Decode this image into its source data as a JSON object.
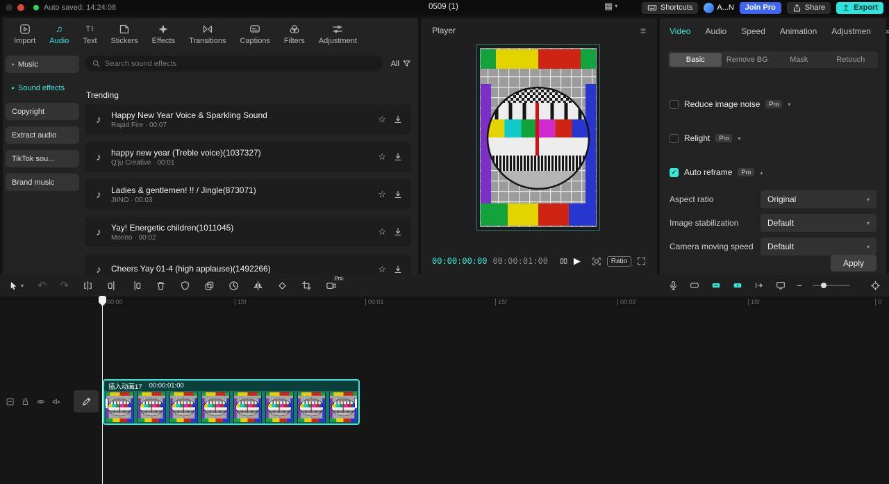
{
  "window": {
    "auto_saved": "Auto saved: 14:24:08",
    "title": "0509 (1)",
    "shortcuts_label": "Shortcuts",
    "account_label": "A...N",
    "join_pro_label": "Join Pro",
    "share_label": "Share",
    "export_label": "Export"
  },
  "media_tabs": [
    "Import",
    "Audio",
    "Text",
    "Stickers",
    "Effects",
    "Transitions",
    "Captions",
    "Filters",
    "Adjustment"
  ],
  "sidebar": [
    "Music",
    "Sound effects",
    "Copyright",
    "Extract audio",
    "TikTok sou...",
    "Brand music"
  ],
  "search": {
    "placeholder": "Search sound effects",
    "filter_label": "All"
  },
  "sounds": {
    "heading": "Trending",
    "items": [
      {
        "title": "Happy New Year Voice & Sparkling Sound",
        "meta": "Rapid Fire · 00:07"
      },
      {
        "title": "happy new year (Treble voice)(1037327)",
        "meta": "Q'ju Creative · 00:01"
      },
      {
        "title": "Ladies & gentlemen! !! / Jingle(873071)",
        "meta": "JIINO · 00:03"
      },
      {
        "title": "Yay! Energetic children(1011045)",
        "meta": "Morino · 00:02"
      },
      {
        "title": "Cheers Yay 01-4 (high applause)(1492266)",
        "meta": ""
      }
    ]
  },
  "player": {
    "title": "Player",
    "current_time": "00:00:00:00",
    "total_time": "00:00:01:00",
    "ratio_label": "Ratio"
  },
  "inspector": {
    "tabs": [
      "Video",
      "Audio",
      "Speed",
      "Animation",
      "Adjustmen"
    ],
    "subtabs": [
      "Basic",
      "Remove BG",
      "Mask",
      "Retouch"
    ],
    "toggles": [
      {
        "label": "Reduce image noise",
        "badge": "Pro",
        "checked": false
      },
      {
        "label": "Relight",
        "badge": "Pro",
        "checked": false
      },
      {
        "label": "Auto reframe",
        "badge": "Pro",
        "checked": true
      }
    ],
    "fields": [
      {
        "label": "Aspect ratio",
        "value": "Original"
      },
      {
        "label": "Image stabilization",
        "value": "Default"
      },
      {
        "label": "Camera moving speed",
        "value": "Default"
      }
    ],
    "apply_label": "Apply"
  },
  "toolbar": {
    "pro_badge": "Pro"
  },
  "timeline": {
    "ruler": [
      "00:00",
      "15f",
      "00:01",
      "15f",
      "00:02",
      "15f",
      "0"
    ],
    "clip": {
      "name": "插入动画17",
      "duration": "00:00:01:00"
    }
  },
  "icons": {
    "note": "♪",
    "audio_tab": "♫",
    "text_tab": "TI",
    "star": "☆",
    "play": "▶",
    "caret_down": "▾",
    "caret_up": "▴",
    "caret_right": "▸",
    "more": "»",
    "menu": "≡",
    "undo": "↶",
    "redo": "↷",
    "layout": "▦",
    "check": "✓",
    "minus": "−"
  },
  "colors": {
    "accent": "#3ae8da",
    "join_pro_blue": "#3f66f0",
    "export_cyan": "#2fe3dd"
  }
}
